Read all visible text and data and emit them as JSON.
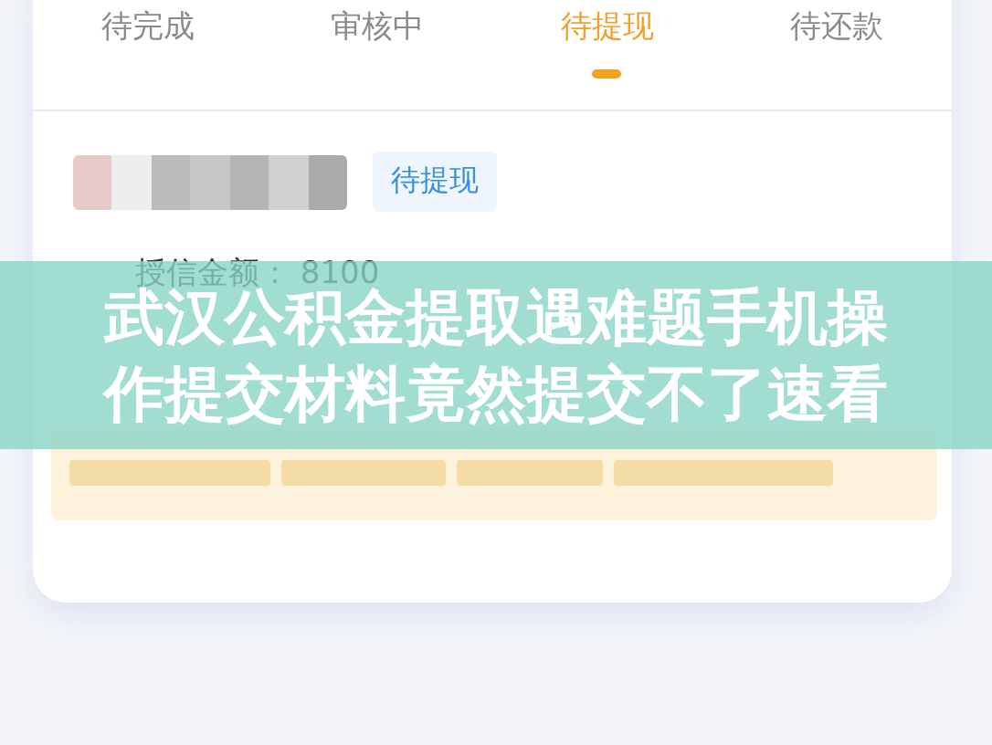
{
  "tabs": [
    {
      "label": "待完成",
      "selected": false
    },
    {
      "label": "审核中",
      "selected": false
    },
    {
      "label": "待提现",
      "selected": true
    },
    {
      "label": "待还款",
      "selected": false
    }
  ],
  "record": {
    "status": "待提现",
    "amount_label": "授信金额：",
    "amount": "8100"
  },
  "caption": "武汉公积金提取遇难题手机操作提交材料竟然提交不了速看"
}
